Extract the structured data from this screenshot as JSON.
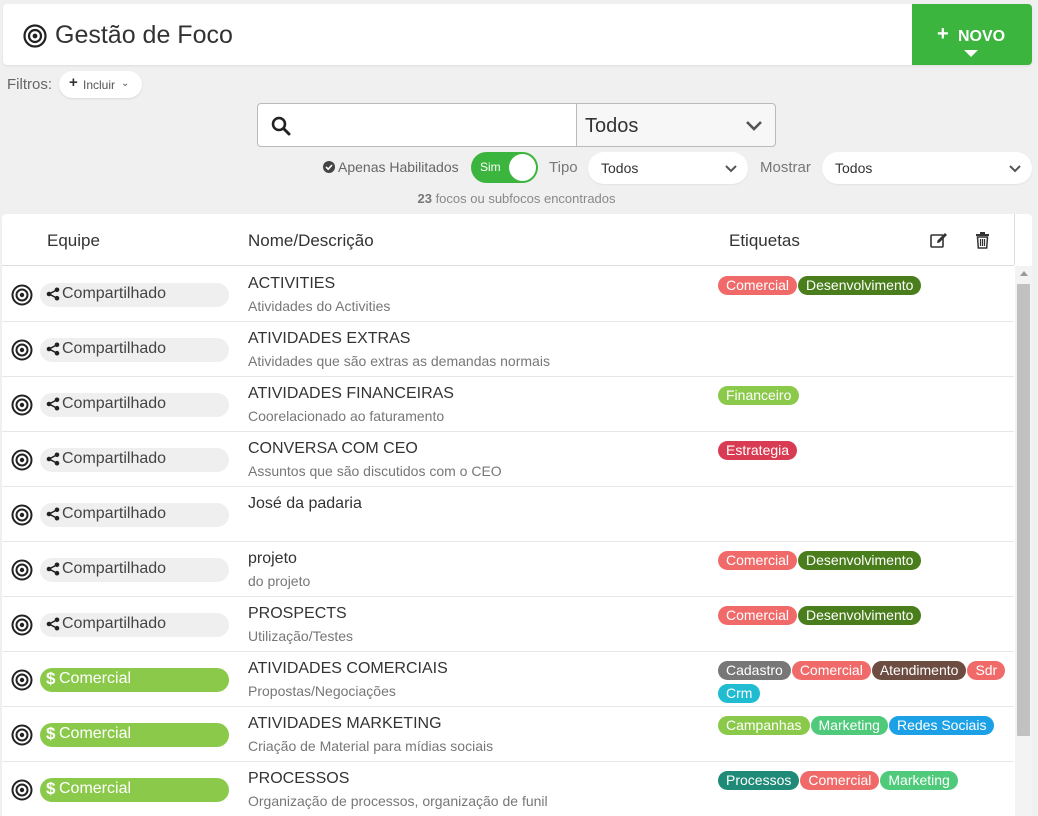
{
  "header": {
    "title": "Gestão de Foco",
    "new_button": "NOVO"
  },
  "filters": {
    "label": "Filtros:",
    "include": "Incluir"
  },
  "search": {
    "placeholder": "",
    "value": "",
    "scope": "Todos"
  },
  "options": {
    "only_enabled_label": "Apenas Habilitados",
    "toggle_label": "Sim",
    "tipo_label": "Tipo",
    "tipo_value": "Todos",
    "mostrar_label": "Mostrar",
    "mostrar_value": "Todos"
  },
  "result": {
    "count": "23",
    "text": "focos ou subfocos encontrados"
  },
  "table": {
    "headers": {
      "team": "Equipe",
      "name": "Nome/Descrição",
      "tags": "Etiquetas"
    },
    "rows": [
      {
        "team": "Compartilhado",
        "team_type": "shared",
        "name": "ACTIVITIES",
        "desc": "Atividades do Activities",
        "tags": [
          {
            "label": "Comercial",
            "color": "#f06a6a"
          },
          {
            "label": "Desenvolvimento",
            "color": "#4a7d1b"
          }
        ]
      },
      {
        "team": "Compartilhado",
        "team_type": "shared",
        "name": "ATIVIDADES EXTRAS",
        "desc": "Atividades que são extras as demandas normais",
        "tags": []
      },
      {
        "team": "Compartilhado",
        "team_type": "shared",
        "name": "ATIVIDADES FINANCEIRAS",
        "desc": "Coorelacionado ao faturamento",
        "tags": [
          {
            "label": "Financeiro",
            "color": "#8bc94a"
          }
        ]
      },
      {
        "team": "Compartilhado",
        "team_type": "shared",
        "name": "CONVERSA COM CEO",
        "desc": "Assuntos que são discutidos com o CEO",
        "tags": [
          {
            "label": "Estrategia",
            "color": "#d93b53"
          }
        ]
      },
      {
        "team": "Compartilhado",
        "team_type": "shared",
        "name": "José da padaria",
        "desc": "",
        "tags": []
      },
      {
        "team": "Compartilhado",
        "team_type": "shared",
        "name": "projeto",
        "desc": "do projeto",
        "tags": [
          {
            "label": "Comercial",
            "color": "#f06a6a"
          },
          {
            "label": "Desenvolvimento",
            "color": "#4a7d1b"
          }
        ]
      },
      {
        "team": "Compartilhado",
        "team_type": "shared",
        "name": "PROSPECTS",
        "desc": "Utilização/Testes",
        "tags": [
          {
            "label": "Comercial",
            "color": "#f06a6a"
          },
          {
            "label": "Desenvolvimento",
            "color": "#4a7d1b"
          }
        ]
      },
      {
        "team": "Comercial",
        "team_type": "commercial",
        "name": "ATIVIDADES COMERCIAIS",
        "desc": "Propostas/Negociações",
        "tags": [
          {
            "label": "Cadastro",
            "color": "#777777"
          },
          {
            "label": "Comercial",
            "color": "#f06a6a"
          },
          {
            "label": "Atendimento",
            "color": "#6d4c41"
          },
          {
            "label": "Sdr",
            "color": "#f06a6a"
          },
          {
            "label": "Crm",
            "color": "#1fbcd2"
          }
        ]
      },
      {
        "team": "Comercial",
        "team_type": "commercial",
        "name": "ATIVIDADES MARKETING",
        "desc": "Criação de Material para mídias sociais",
        "tags": [
          {
            "label": "Campanhas",
            "color": "#8bc94a"
          },
          {
            "label": "Marketing",
            "color": "#4fc97a"
          },
          {
            "label": "Redes Sociais",
            "color": "#1da1e6"
          }
        ]
      },
      {
        "team": "Comercial",
        "team_type": "commercial",
        "name": "PROCESSOS",
        "desc": "Organização de processos, organização de funil",
        "tags": [
          {
            "label": "Processos",
            "color": "#1f8a78"
          },
          {
            "label": "Comercial",
            "color": "#f06a6a"
          },
          {
            "label": "Marketing",
            "color": "#4fc97a"
          }
        ]
      }
    ]
  }
}
